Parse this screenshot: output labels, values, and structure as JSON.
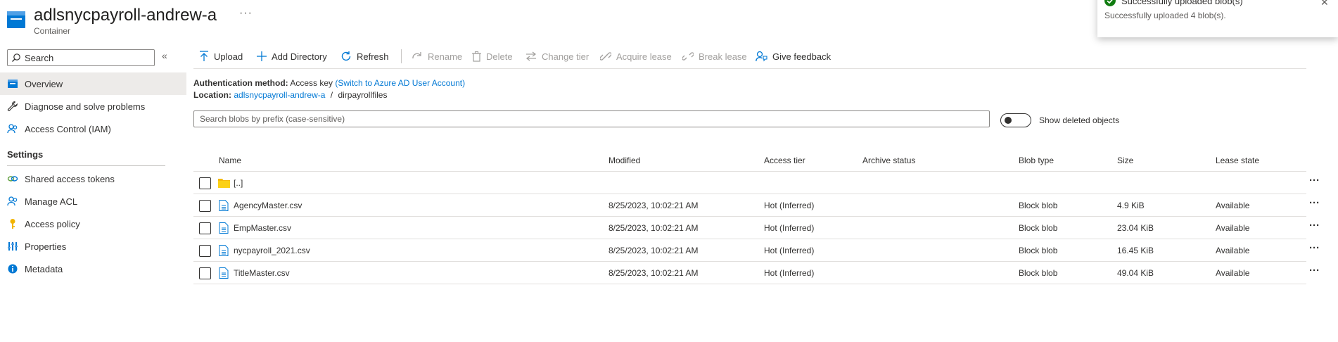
{
  "header": {
    "title": "adlsnycpayroll-andrew-a",
    "subtitle": "Container",
    "more": "···"
  },
  "sidebar": {
    "search_placeholder": "Search",
    "collapse": "«",
    "items": [
      {
        "label": "Overview",
        "icon": "container-icon"
      },
      {
        "label": "Diagnose and solve problems",
        "icon": "wrench-icon"
      },
      {
        "label": "Access Control (IAM)",
        "icon": "people-icon"
      }
    ],
    "settings_header": "Settings",
    "settings_items": [
      {
        "label": "Shared access tokens",
        "icon": "link-icon"
      },
      {
        "label": "Manage ACL",
        "icon": "people-icon"
      },
      {
        "label": "Access policy",
        "icon": "key-icon"
      },
      {
        "label": "Properties",
        "icon": "sliders-icon"
      },
      {
        "label": "Metadata",
        "icon": "info-icon"
      }
    ]
  },
  "toolbar": {
    "upload": "Upload",
    "add_directory": "Add Directory",
    "refresh": "Refresh",
    "rename": "Rename",
    "delete": "Delete",
    "change_tier": "Change tier",
    "acquire_lease": "Acquire lease",
    "break_lease": "Break lease",
    "give_feedback": "Give feedback"
  },
  "info": {
    "auth_label": "Authentication method:",
    "auth_value": "Access key",
    "auth_link": "(Switch to Azure AD User Account)",
    "location_label": "Location:",
    "location_link": "adlsnycpayroll-andrew-a",
    "location_sep": "/",
    "location_folder": "dirpayrollfiles"
  },
  "blob_search": {
    "placeholder": "Search blobs by prefix (case-sensitive)"
  },
  "show_deleted": {
    "label": "Show deleted objects",
    "on": false
  },
  "table": {
    "columns": [
      "Name",
      "Modified",
      "Access tier",
      "Archive status",
      "Blob type",
      "Size",
      "Lease state"
    ],
    "parent_row": "[..]",
    "rows": [
      {
        "name": "AgencyMaster.csv",
        "modified": "8/25/2023, 10:02:21 AM",
        "tier": "Hot (Inferred)",
        "archive": "",
        "type": "Block blob",
        "size": "4.9 KiB",
        "lease": "Available"
      },
      {
        "name": "EmpMaster.csv",
        "modified": "8/25/2023, 10:02:21 AM",
        "tier": "Hot (Inferred)",
        "archive": "",
        "type": "Block blob",
        "size": "23.04 KiB",
        "lease": "Available"
      },
      {
        "name": "nycpayroll_2021.csv",
        "modified": "8/25/2023, 10:02:21 AM",
        "tier": "Hot (Inferred)",
        "archive": "",
        "type": "Block blob",
        "size": "16.45 KiB",
        "lease": "Available"
      },
      {
        "name": "TitleMaster.csv",
        "modified": "8/25/2023, 10:02:21 AM",
        "tier": "Hot (Inferred)",
        "archive": "",
        "type": "Block blob",
        "size": "49.04 KiB",
        "lease": "Available"
      }
    ],
    "row_more": "···"
  },
  "notification": {
    "title": "Successfully uploaded blob(s)",
    "message": "Successfully uploaded 4 blob(s)."
  },
  "colors": {
    "accent": "#0078d4",
    "success": "#107c10",
    "folder": "#f5b90a"
  }
}
